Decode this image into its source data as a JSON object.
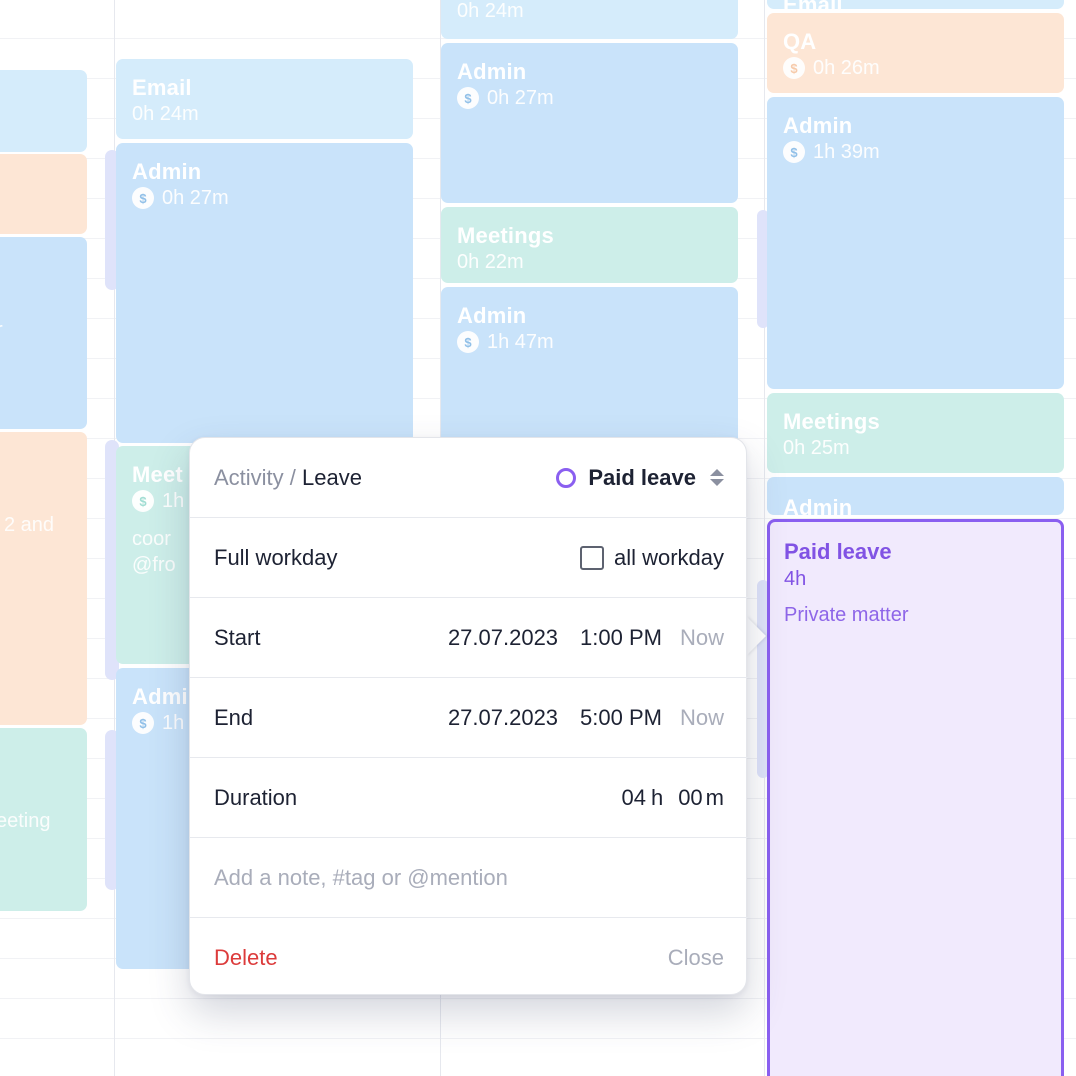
{
  "calendar": {
    "col1": {
      "ev1": {
        "title": "Email",
        "duration": "0h 24m"
      },
      "ev2": {
        "title": "Admin",
        "duration": "0h 27m"
      },
      "ev3": {
        "title": "Meet",
        "duration": "1h",
        "note1": "coor",
        "note2": "@fro"
      },
      "ev4": {
        "title": "Admi",
        "duration": "1h"
      }
    },
    "col0": {
      "ev1": {
        "note": "r"
      },
      "ev2": {
        "note": "2 and"
      },
      "ev3": {
        "note": "eeting"
      }
    },
    "col2": {
      "ev0": {
        "duration": "0h 24m"
      },
      "ev1": {
        "title": "Admin",
        "duration": "0h 27m"
      },
      "ev2": {
        "title": "Meetings",
        "duration": "0h 22m"
      },
      "ev3": {
        "title": "Admin",
        "duration": "1h 47m"
      }
    },
    "col3": {
      "ev0": {
        "title": "Email"
      },
      "ev1": {
        "title": "QA",
        "duration": "0h 26m"
      },
      "ev2": {
        "title": "Admin",
        "duration": "1h 39m"
      },
      "ev3": {
        "title": "Meetings",
        "duration": "0h 25m"
      },
      "ev4": {
        "title": "Admin"
      }
    },
    "paid_leave": {
      "title": "Paid leave",
      "duration": "4h",
      "note": "Private matter"
    },
    "billable_symbol": "$"
  },
  "popup": {
    "breadcrumb_parent": "Activity /",
    "breadcrumb_current": "Leave",
    "activity_value": "Paid leave",
    "full_workday_label": "Full workday",
    "all_workday_label": "all workday",
    "start": {
      "label": "Start",
      "date": "27.07.2023",
      "time": "1:00 PM",
      "now": "Now"
    },
    "end": {
      "label": "End",
      "date": "27.07.2023",
      "time": "5:00 PM",
      "now": "Now"
    },
    "duration": {
      "label": "Duration",
      "hours": "04",
      "hours_unit": "h",
      "minutes": "00",
      "minutes_unit": "m"
    },
    "note_placeholder": "Add a note, #tag or @mention",
    "delete_label": "Delete",
    "close_label": "Close"
  },
  "colors": {
    "accent_purple": "#8a5ff0",
    "delete_red": "#dc3b3b",
    "event_blue": "#c9e3fa",
    "event_peach": "#fde6d5",
    "event_mint": "#cdeee9",
    "paid_leave_bg": "#f1eafd"
  }
}
